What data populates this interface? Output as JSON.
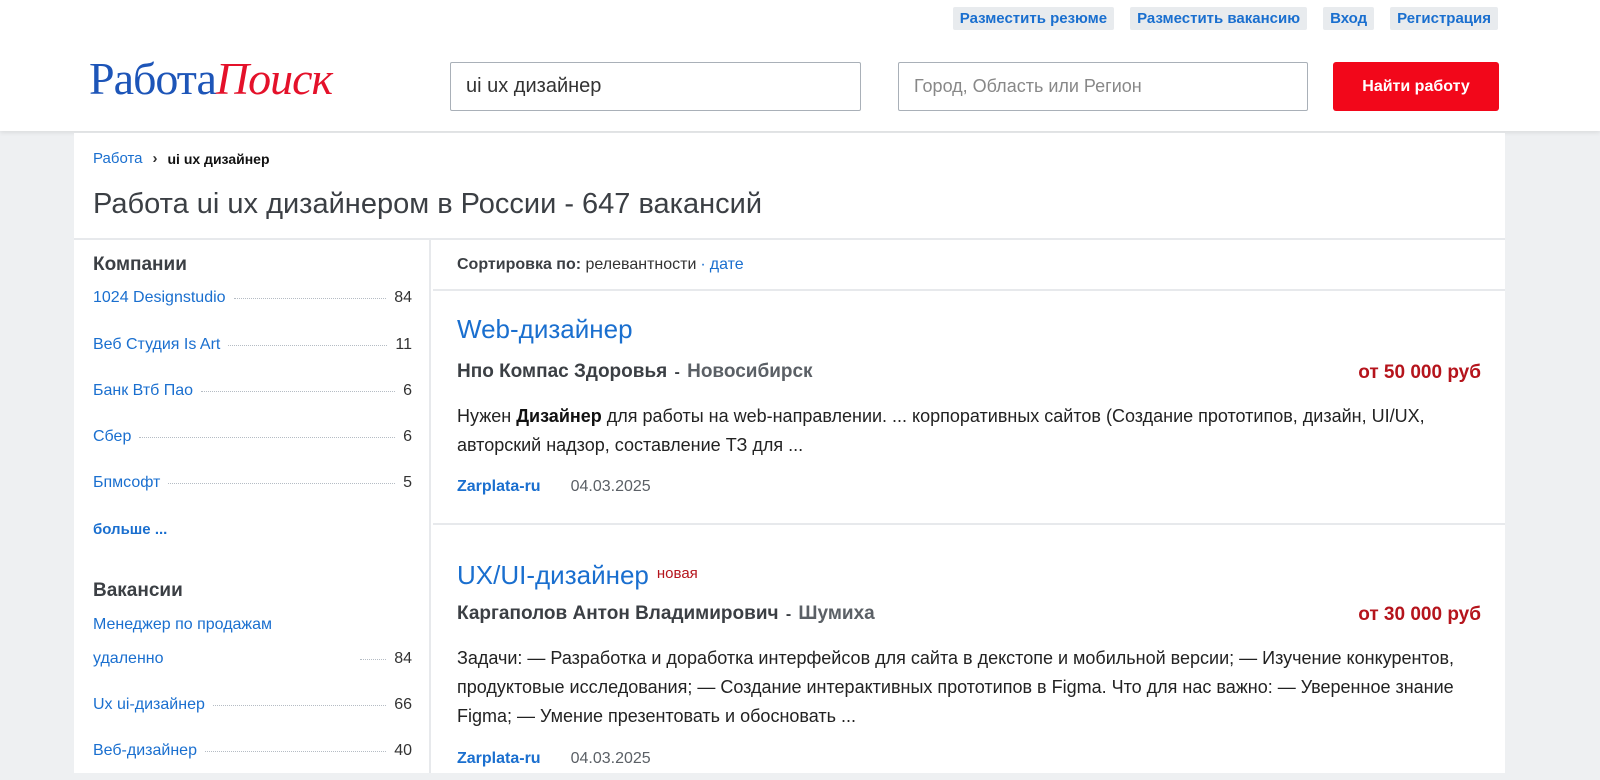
{
  "header": {
    "top_links": [
      "Разместить резюме",
      "Разместить вакансию",
      "Вход",
      "Регистрация"
    ],
    "logo_part1": "Работа",
    "logo_part2": "Поиск",
    "query_value": "ui ux дизайнер",
    "location_placeholder": "Город, Область или Регион",
    "search_button": "Найти работу"
  },
  "breadcrumb": {
    "root": "Работа",
    "sep": "›",
    "current": "ui ux дизайнер"
  },
  "page_title": "Работа ui ux дизайнером в России - 647 вакансий",
  "sidebar": {
    "companies_heading": "Компании",
    "companies": [
      {
        "name": "1024 Designstudio",
        "count": "84"
      },
      {
        "name": "Веб Студия Is Art",
        "count": "11"
      },
      {
        "name": "Банк Втб Пао",
        "count": "6"
      },
      {
        "name": "Сбер",
        "count": "6"
      },
      {
        "name": "Бпмсофт",
        "count": "5"
      }
    ],
    "more": "больше ...",
    "vacancies_heading": "Вакансии",
    "vacancies": [
      {
        "name_line1": "Менеджер по продажам",
        "name_line2": "удаленно",
        "count": "84"
      },
      {
        "name": "Ux ui-дизайнер",
        "count": "66"
      },
      {
        "name": "Веб-дизайнер",
        "count": "40"
      }
    ]
  },
  "sort": {
    "label": "Сортировка по:",
    "relevance": "релевантности",
    "dot": "·",
    "date": "дате"
  },
  "jobs": [
    {
      "title": "Web-дизайнер",
      "badge": "",
      "company": "Нпо Компас Здоровья",
      "dash": "-",
      "city": "Новосибирск",
      "salary": "от 50 000 руб",
      "snippet_pre": "Нужен ",
      "snippet_bold": "Дизайнер",
      "snippet_post": " для работы на web-направлении. ... корпоративных сайтов (Создание прототипов, дизайн, UI/UX, авторский надзор, составление ТЗ для ...",
      "source": "Zarplata-ru",
      "date": "04.03.2025"
    },
    {
      "title": "UX/UI-дизайнер",
      "badge": "новая",
      "company": "Каргаполов Антон Владимирович",
      "dash": "-",
      "city": "Шумиха",
      "salary": "от 30 000 руб",
      "snippet_pre": "Задачи: — Разработка и доработка интерфейсов для сайта в декстопе и мобильной версии; — Изучение конкурентов, продуктовые исследования; — Создание интерактивных прототипов в Figma. Что для нас важно: — Уверенное знание Figma; — Умение презентовать и обосновать ...",
      "snippet_bold": "",
      "snippet_post": "",
      "source": "Zarplata-ru",
      "date": "04.03.2025"
    }
  ],
  "colors": {
    "brand_blue": "#1d55b8",
    "brand_red": "#e4112a",
    "button_red": "#f2071a",
    "salary_red": "#b5141c",
    "link": "#1a6fcf"
  }
}
